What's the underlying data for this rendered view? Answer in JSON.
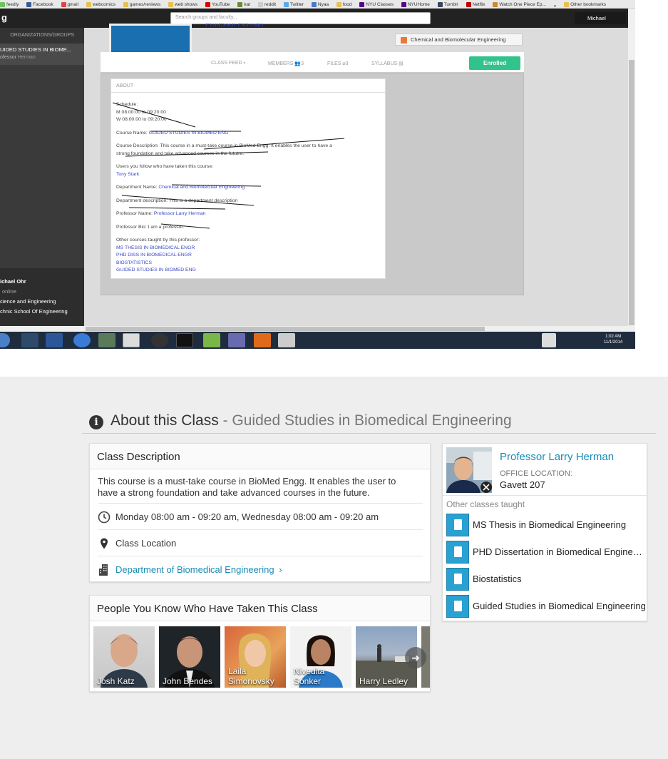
{
  "browser": {
    "bookmarks": [
      "feedly",
      "Facebook",
      "gmail",
      "webcomics",
      "games/reviews",
      "web shows",
      "YouTube",
      "kat",
      "reddit",
      "Twitter",
      "Nyaa",
      "food",
      "NYU Classes",
      "NYUHome",
      "Tumblr",
      "Netflix",
      "Watch One Piece Ep...",
      "»",
      "Other bookmarks"
    ]
  },
  "app": {
    "logo": "g",
    "search_placeholder": "Search groups and faculty...",
    "user_name": "Michael"
  },
  "sidebar": {
    "section_header": "ORGANIZATIONS/GROUPS",
    "course_title": "UIDED STUDIES IN BIOME...",
    "course_professor_prefix": "ofessor",
    "course_professor_name": "Herman",
    "profile_name": "ichael Ohr",
    "profile_status": "online",
    "profile_line1": "cience and Engineering",
    "profile_line2": "chnic School Of Engineering"
  },
  "course_header": {
    "professor_partial": "Professor Herman",
    "department_chip": "Chemical and Biomolecular Engineering",
    "tabs": {
      "class_feed": "CLASS FEED",
      "members": "MEMBERS",
      "members_count": "3",
      "files": "FILES",
      "files_count": "3",
      "syllabus": "SYLLABUS"
    },
    "enrolled_label": "Enrolled"
  },
  "about_box": {
    "header": "ABOUT",
    "schedule_label": "Schedule:",
    "schedule_m": "M 08:00:00 to 09:20:00",
    "schedule_w": "W 08:00:00 to 09:20:00",
    "course_name_label": "Course Name:",
    "course_name": "GUIDED STUDIES IN BIOMED ENG",
    "description_line1": "Course Description: This course in a must-take course in BioMed Engg. It enables the user to have a",
    "description_line2": "strong foundation and take advanced courses in the fututre.",
    "users_follow_label": "Users you follow who have taken this course:",
    "users_follow": "Tony Stark",
    "dept_name_label": "Department Name:",
    "dept_name": "Chemical and Biomolecular Engineering",
    "dept_desc": "Department description: This is a department description",
    "prof_name_label": "Professor Name:",
    "prof_name": "Professor Larry Herman",
    "prof_bio": "Professor Bio: I am a professor.",
    "other_courses_label": "Other courses taught by this professor:",
    "other_courses": [
      "MS THESIS IN BIOMEDICAL ENGR",
      "PHD DISS IN BIOMEDICAL ENGR",
      "BIOSTATISTICS",
      "GUIDED STUDIES IN BIOMED ENG"
    ]
  },
  "taskbar": {
    "time": "1:02 AM",
    "date": "11/1/2014"
  },
  "about_class": {
    "title": "About this Class",
    "separator": " - ",
    "subtitle": "Guided Studies in Biomedical Engineering",
    "description_card": {
      "header": "Class Description",
      "text": "This course is a must-take course in BioMed Engg. It enables the user to have a strong foundation and take advanced courses in the future.",
      "schedule": "Monday 08:00 am - 09:20 am, Wednesday 08:00 am - 09:20 am",
      "location": "Class Location",
      "department": "Department of Biomedical Engineering"
    },
    "people_card": {
      "header": "People You Know Who Have Taken This Class",
      "people": [
        {
          "name": "Josh Katz"
        },
        {
          "name": "John Bendes"
        },
        {
          "name": "Laila Simonovsky"
        },
        {
          "name": "Nivedita Sonker"
        },
        {
          "name": "Harry Ledley"
        }
      ]
    },
    "professor_card": {
      "name": "Professor Larry Herman",
      "office_label": "OFFICE LOCATION:",
      "office_value": "Gavett 207",
      "other_classes_label": "Other classes taught",
      "classes": [
        "MS Thesis in Biomedical Engineering",
        "PHD Dissertation in Biomedical Engineering",
        "Biostatistics",
        "Guided Studies in Biomedical Engineering"
      ]
    }
  },
  "colors": {
    "accent": "#1a8bb5",
    "enrolled_green": "#32c38d",
    "book_blue": "#2aa1d3",
    "link_purple": "#3a49c5"
  }
}
